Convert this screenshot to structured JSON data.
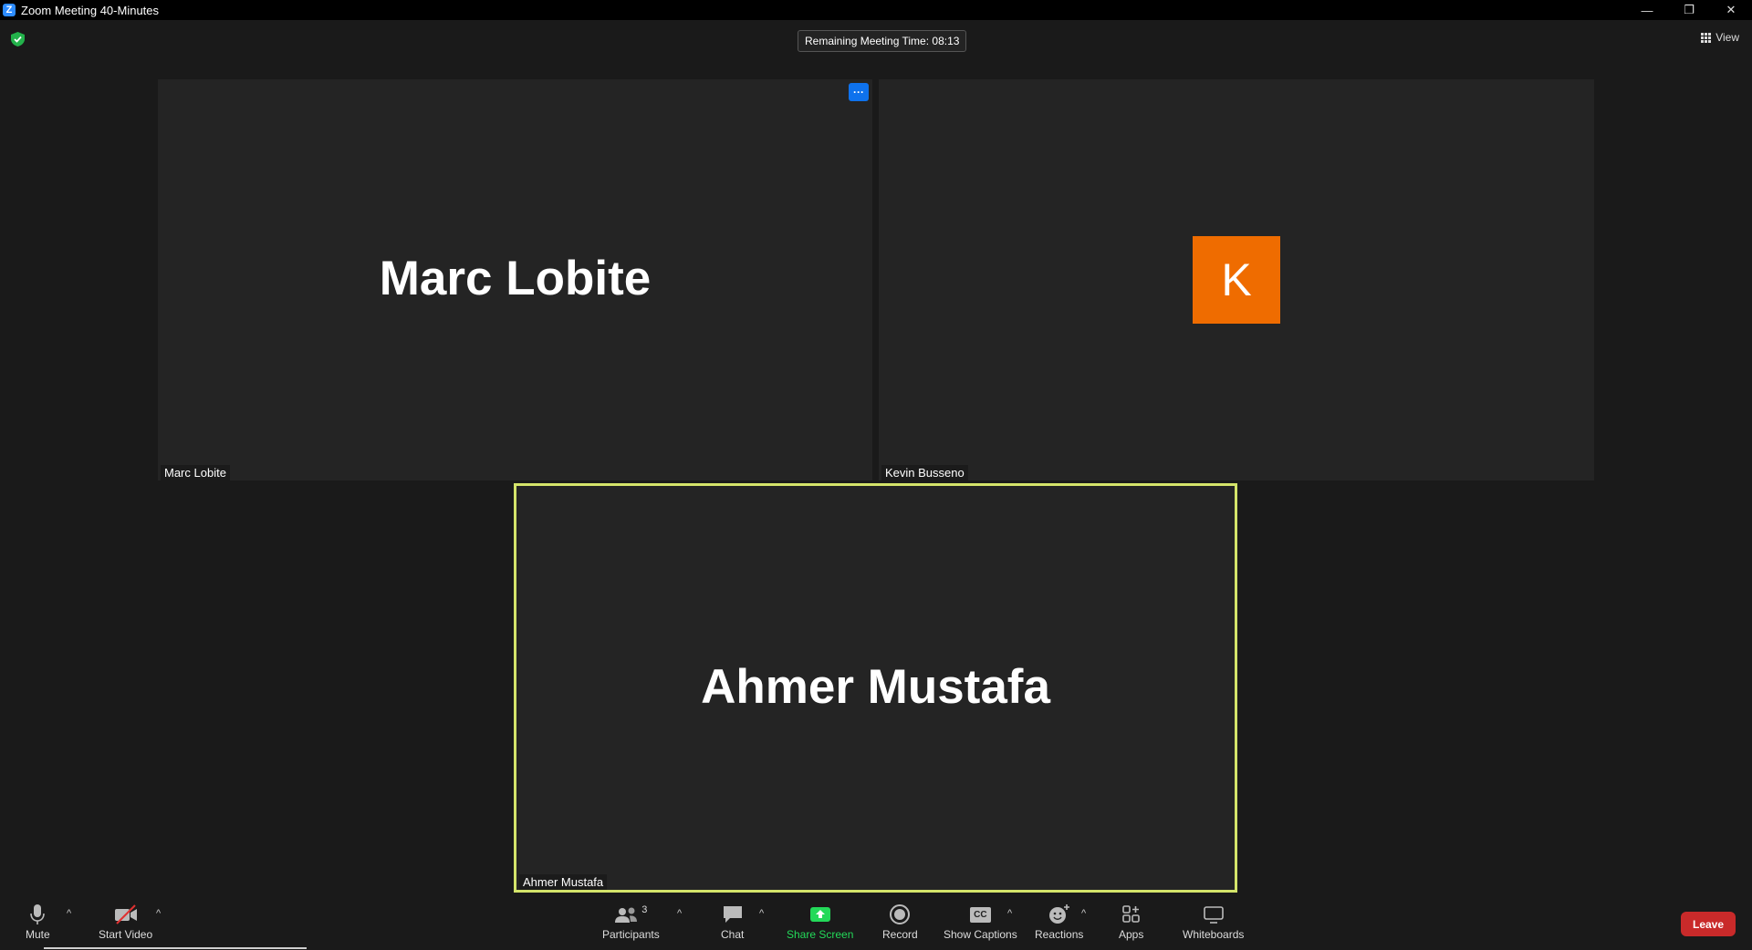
{
  "window": {
    "title": "Zoom Meeting 40-Minutes",
    "minimize": "—",
    "restore": "❐",
    "close": "✕"
  },
  "top": {
    "remaining_time": "Remaining Meeting Time: 08:13",
    "view_label": "View"
  },
  "tiles": [
    {
      "display_name": "Marc Lobite",
      "name_tag": "Marc Lobite",
      "more_label": "···"
    },
    {
      "avatar_letter": "K",
      "avatar_color": "#ef6c00",
      "name_tag": "Kevin Busseno"
    },
    {
      "display_name": "Ahmer Mustafa",
      "name_tag": "Ahmer Mustafa",
      "active_speaker_color": "#d4e46a"
    }
  ],
  "toolbar": {
    "mute_label": "Mute",
    "start_video_label": "Start Video",
    "participants_label": "Participants",
    "participants_count": "3",
    "chat_label": "Chat",
    "share_screen_label": "Share Screen",
    "record_label": "Record",
    "show_captions_label": "Show Captions",
    "captions_icon_text": "CC",
    "reactions_label": "Reactions",
    "apps_label": "Apps",
    "whiteboards_label": "Whiteboards",
    "leave_label": "Leave",
    "caret": "^"
  },
  "colors": {
    "share_green": "#23d959",
    "leave_red": "#c92a2a",
    "accent_blue": "#0e72ed"
  }
}
